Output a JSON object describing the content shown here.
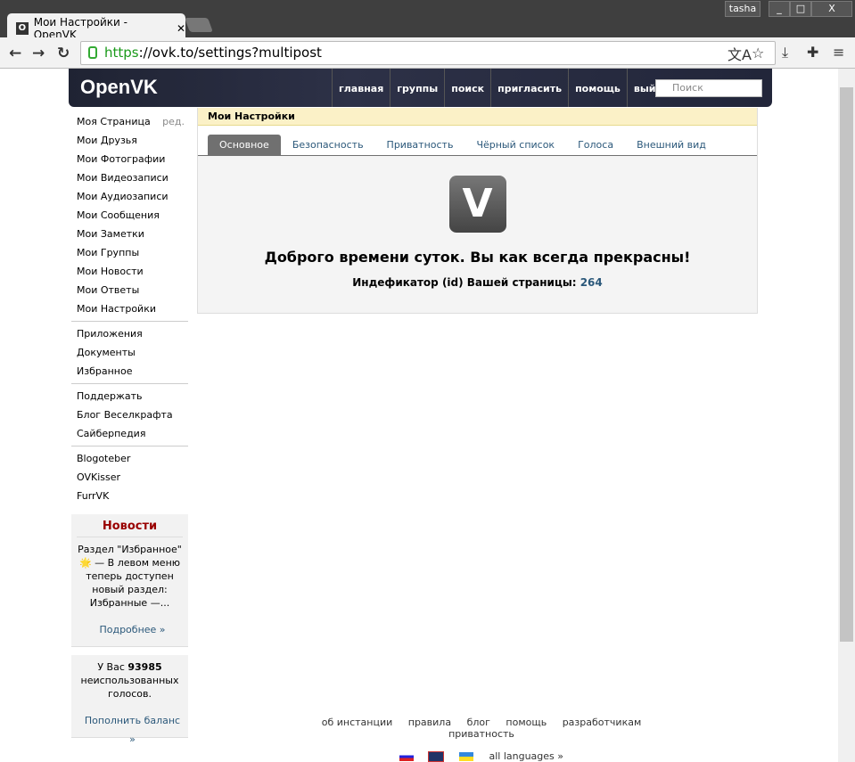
{
  "browser": {
    "user": "tasha",
    "tab_title": "Мои Настройки - OpenVK",
    "url_scheme": "https",
    "url_rest": "://ovk.to/settings?multipost"
  },
  "header": {
    "logo": "OpenVK",
    "nav": [
      "главная",
      "группы",
      "поиск",
      "пригласить",
      "помощь",
      "выйти"
    ],
    "search_placeholder": "Поиск"
  },
  "sidebar": {
    "edit": "ред.",
    "group1": [
      "Моя Страница",
      "Мои Друзья",
      "Мои Фотографии",
      "Мои Видеозаписи",
      "Мои Аудиозаписи",
      "Мои Сообщения",
      "Мои Заметки",
      "Мои Группы",
      "Мои Новости",
      "Мои Ответы",
      "Мои Настройки"
    ],
    "group2": [
      "Приложения",
      "Документы",
      "Избранное"
    ],
    "group3": [
      "Поддержать",
      "Блог Веселкрафта",
      "Сайберпедия"
    ],
    "group4": [
      "Blogoteber",
      "OVKisser",
      "FurrVK"
    ]
  },
  "news": {
    "title": "Новости",
    "text": "Раздел \"Избранное\" 🌟 — В левом меню теперь доступен новый раздел: Избранные —...",
    "more": "Подробнее »"
  },
  "votes": {
    "prefix": "У Вас",
    "count": "93985",
    "suffix": "неиспользованных голосов.",
    "link": "Пополнить баланс »"
  },
  "main": {
    "title": "Мои Настройки",
    "tabs": [
      "Основное",
      "Безопасность",
      "Приватность",
      "Чёрный список",
      "Голоса",
      "Внешний вид"
    ],
    "logo_letter": "V",
    "greeting": "Доброго времени суток. Вы как всегда прекрасны!",
    "id_label": "Индефикатор (id) Вашей страницы:",
    "id_value": "264"
  },
  "footer": {
    "links": [
      "об инстанции",
      "правила",
      "блог",
      "помощь",
      "разработчикам",
      "приватность"
    ],
    "all_languages": "all languages »"
  }
}
